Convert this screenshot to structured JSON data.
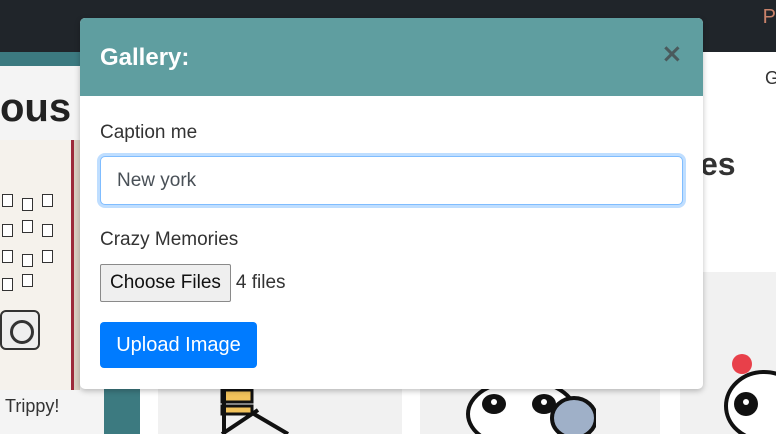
{
  "background": {
    "nav_link_fragment": "P",
    "left_heading_fragment": "ous",
    "left_caption": "Trippy!",
    "right_small_fragment": "G",
    "right_heading_fragment": "es"
  },
  "modal": {
    "title": "Gallery:",
    "close_symbol": "×",
    "caption_label": "Caption me",
    "caption_value": "New york",
    "memories_label": "Crazy Memories",
    "choose_files_label": "Choose Files",
    "file_count": "4 files",
    "upload_label": "Upload Image"
  },
  "colors": {
    "header": "#5f9ea0",
    "primary_button": "#007bff",
    "navbar": "#20252a"
  }
}
